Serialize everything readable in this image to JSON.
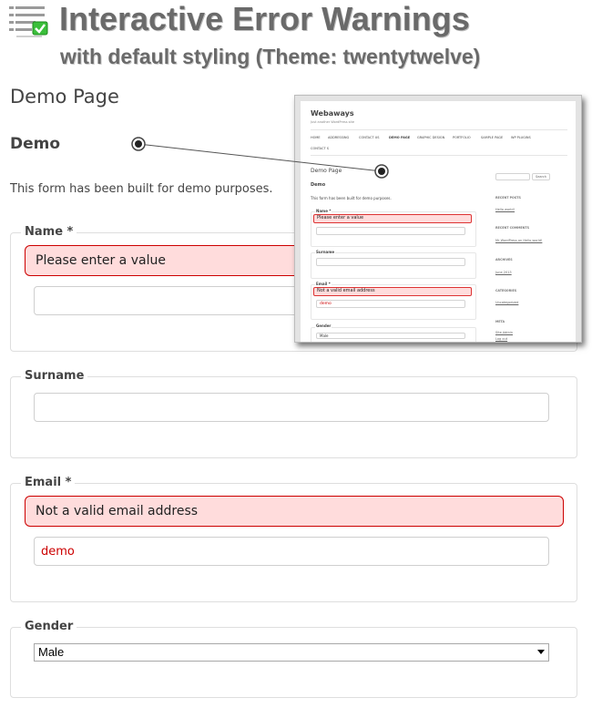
{
  "header": {
    "title": "Interactive Error Warnings",
    "subtitle": "with default styling (Theme: twentytwelve)"
  },
  "page": {
    "heading": "Demo Page",
    "demo_heading": "Demo",
    "intro": "This form has been built for demo purposes."
  },
  "form": {
    "name": {
      "label": "Name *",
      "error": "Please enter a value",
      "value": ""
    },
    "surname": {
      "label": "Surname",
      "value": ""
    },
    "email": {
      "label": "Email *",
      "error": "Not a valid email address",
      "value": "demo"
    },
    "gender": {
      "label": "Gender",
      "selected": "Male"
    }
  },
  "inset": {
    "site_title": "Webaways",
    "tagline": "Just another WordPress site",
    "nav": [
      "HOME",
      "ADDRESSING",
      "CONTACT US",
      "DEMO PAGE",
      "GRAPHIC DESIGN",
      "PORTFOLIO",
      "SAMPLE PAGE",
      "WP PLUGINS"
    ],
    "nav2": "CONTACT S",
    "page_heading": "Demo Page",
    "demo_heading": "Demo",
    "intro": "This form has been built for demo purposes.",
    "name_label": "Name *",
    "name_error": "Please enter a value",
    "surname_label": "Surname",
    "email_label": "Email *",
    "email_error": "Not a valid email address",
    "email_value": "demo",
    "gender_label": "Gender",
    "gender_value": "Male",
    "search_button": "Search",
    "sidebar": {
      "recent_posts": "RECENT POSTS",
      "recent_posts_link": "Hello world!",
      "recent_comments": "RECENT COMMENTS",
      "recent_comments_link": "Mr WordPress on Hello world!",
      "archives": "ARCHIVES",
      "archives_link": "June 2013",
      "categories": "CATEGORIES",
      "categories_link": "Uncategorized",
      "meta": "META",
      "meta_link1": "Site Admin",
      "meta_link2": "Log out"
    }
  }
}
